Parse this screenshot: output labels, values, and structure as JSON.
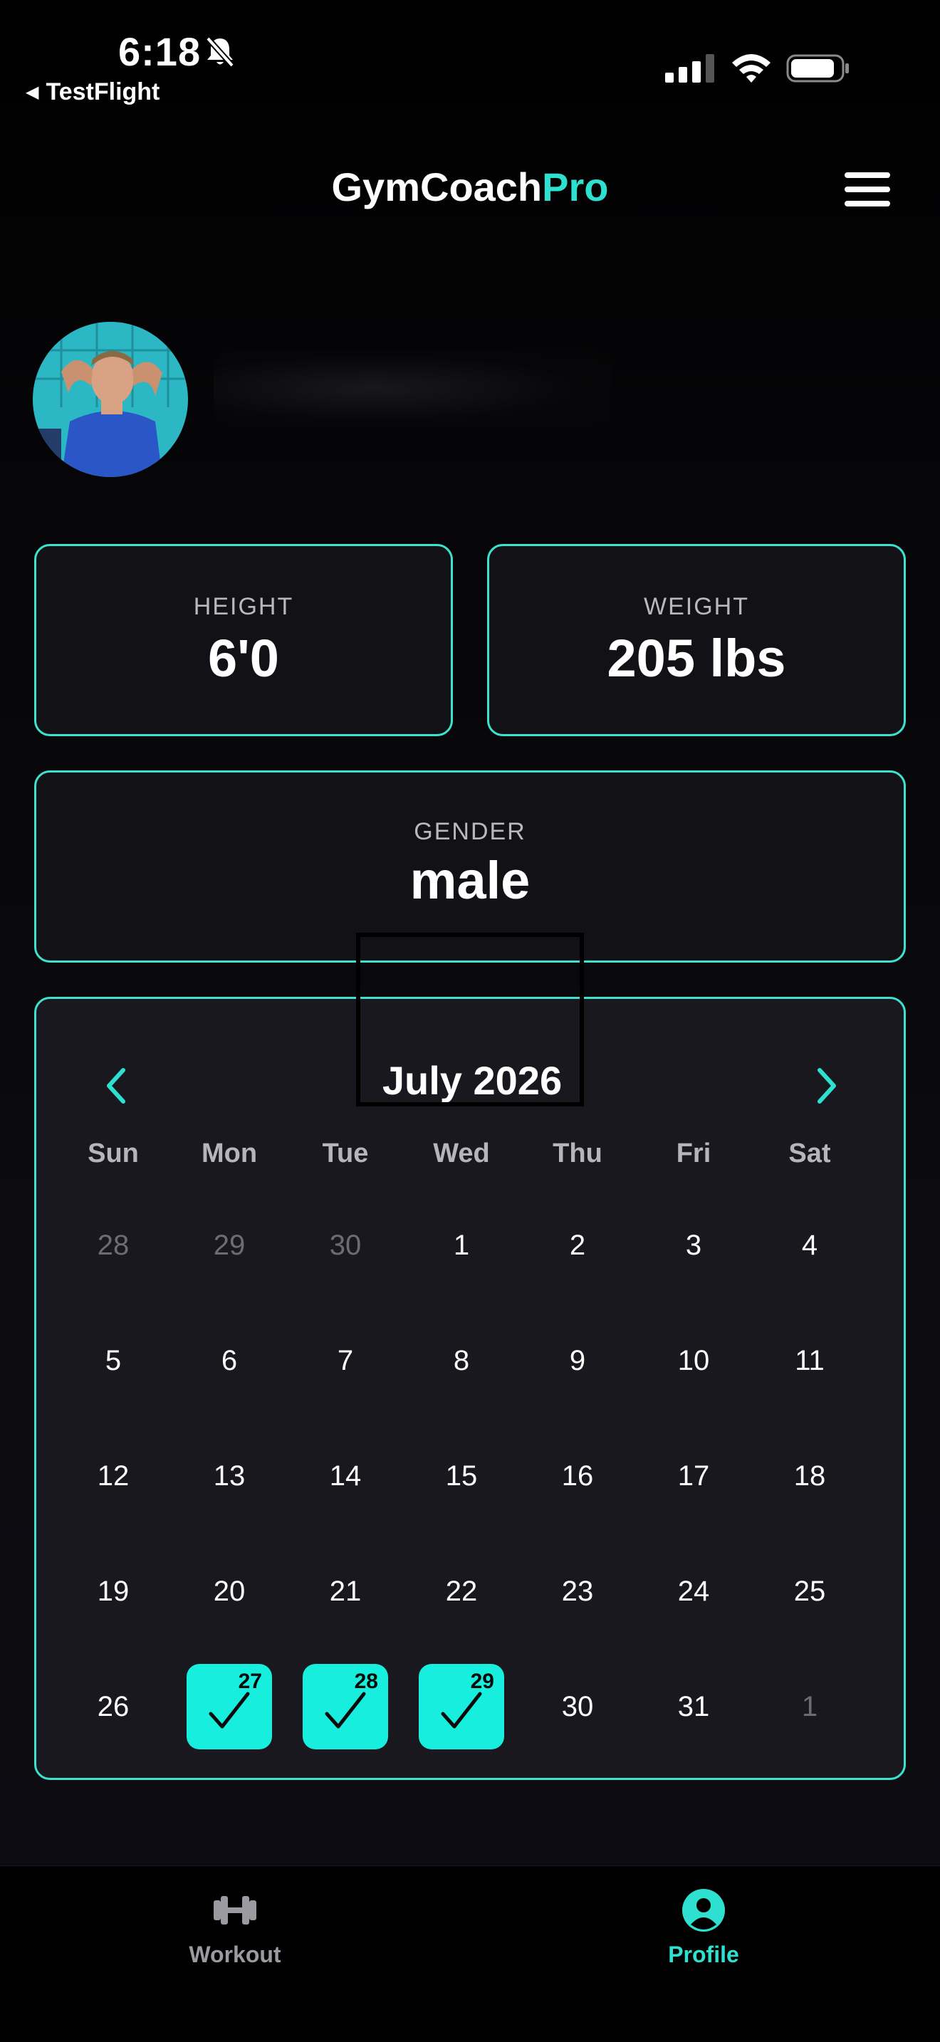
{
  "status_bar": {
    "time": "6:18",
    "back_app": "TestFlight"
  },
  "header": {
    "title_main": "GymCoach",
    "title_accent": "Pro",
    "accent_color": "#2de0cf",
    "menu_icon": "hamburger-menu-icon"
  },
  "profile": {
    "avatar_alt": "Profile photo"
  },
  "stats": {
    "height_label": "HEIGHT",
    "height_value": "6'0",
    "weight_label": "WEIGHT",
    "weight_value": "205 lbs",
    "gender_label": "GENDER",
    "gender_value": "male"
  },
  "calendar": {
    "month_title": "July 2026",
    "weekdays": [
      "Sun",
      "Mon",
      "Tue",
      "Wed",
      "Thu",
      "Fri",
      "Sat"
    ],
    "weeks": [
      [
        {
          "d": "28",
          "muted": true
        },
        {
          "d": "29",
          "muted": true
        },
        {
          "d": "30",
          "muted": true
        },
        {
          "d": "1"
        },
        {
          "d": "2"
        },
        {
          "d": "3"
        },
        {
          "d": "4"
        }
      ],
      [
        {
          "d": "5"
        },
        {
          "d": "6"
        },
        {
          "d": "7"
        },
        {
          "d": "8"
        },
        {
          "d": "9"
        },
        {
          "d": "10"
        },
        {
          "d": "11"
        }
      ],
      [
        {
          "d": "12"
        },
        {
          "d": "13"
        },
        {
          "d": "14"
        },
        {
          "d": "15"
        },
        {
          "d": "16"
        },
        {
          "d": "17"
        },
        {
          "d": "18"
        }
      ],
      [
        {
          "d": "19"
        },
        {
          "d": "20"
        },
        {
          "d": "21"
        },
        {
          "d": "22"
        },
        {
          "d": "23"
        },
        {
          "d": "24"
        },
        {
          "d": "25"
        }
      ],
      [
        {
          "d": "26"
        },
        {
          "d": "27",
          "done": true
        },
        {
          "d": "28",
          "done": true
        },
        {
          "d": "29",
          "done": true
        },
        {
          "d": "30"
        },
        {
          "d": "31"
        },
        {
          "d": "1",
          "muted": true
        }
      ]
    ],
    "completed_color": "#17eedd"
  },
  "tabs": {
    "workout_label": "Workout",
    "profile_label": "Profile",
    "active": "Profile"
  }
}
